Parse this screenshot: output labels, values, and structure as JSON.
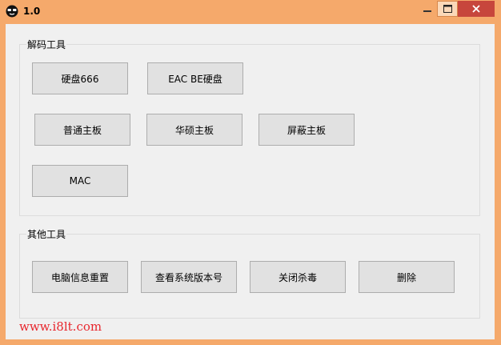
{
  "window": {
    "title": "1.0",
    "icons": {
      "app": "sunglasses-face-icon",
      "minimize": "minimize-icon",
      "maximize": "maximize-icon",
      "close": "close-icon"
    }
  },
  "groups": {
    "decode": {
      "label": "解码工具",
      "buttons": [
        "硬盘666",
        "EAC BE硬盘",
        "普通主板",
        "华硕主板",
        "屏蔽主板",
        "MAC"
      ]
    },
    "other": {
      "label": "其他工具",
      "buttons": [
        "电脑信息重置",
        "查看系统版本号",
        "关闭杀毒",
        "删除"
      ]
    }
  },
  "footer": {
    "url": "www.i8lt.com"
  },
  "colors": {
    "frame": "#f5a96b",
    "close_button": "#c7463c",
    "url_text": "#e8262d",
    "client_bg": "#f0f0f0"
  }
}
